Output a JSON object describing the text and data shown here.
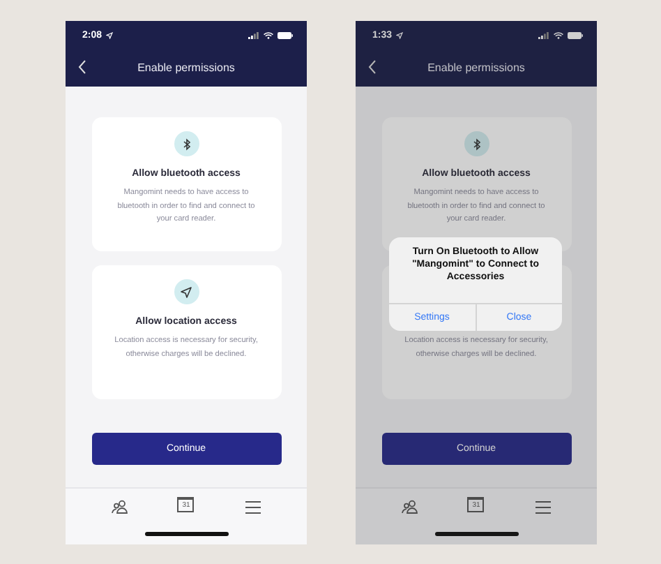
{
  "screens": [
    {
      "time": "2:08",
      "title": "Enable permissions",
      "dimmed": false,
      "cards": [
        {
          "kind": "bluetooth",
          "title": "Allow bluetooth access",
          "body": "Mangomint needs to have access to bluetooth in order to find and connect to your card reader."
        },
        {
          "kind": "location",
          "title": "Allow location access",
          "body": "Location access is necessary for security, otherwise charges will be declined."
        }
      ],
      "button": "Continue",
      "calendar_day": "31"
    },
    {
      "time": "1:33",
      "title": "Enable permissions",
      "dimmed": true,
      "cards": [
        {
          "kind": "bluetooth",
          "title": "Allow bluetooth access",
          "body": "Mangomint needs to have access to bluetooth in order to find and connect to your card reader."
        },
        {
          "body": "Location access is necessary for security, otherwise charges will be declined."
        }
      ],
      "button": "Continue",
      "calendar_day": "31",
      "alert": {
        "title": "Turn On Bluetooth to Allow \"Mangomint\" to Connect to Accessories",
        "buttons": [
          "Settings",
          "Close"
        ]
      }
    }
  ]
}
